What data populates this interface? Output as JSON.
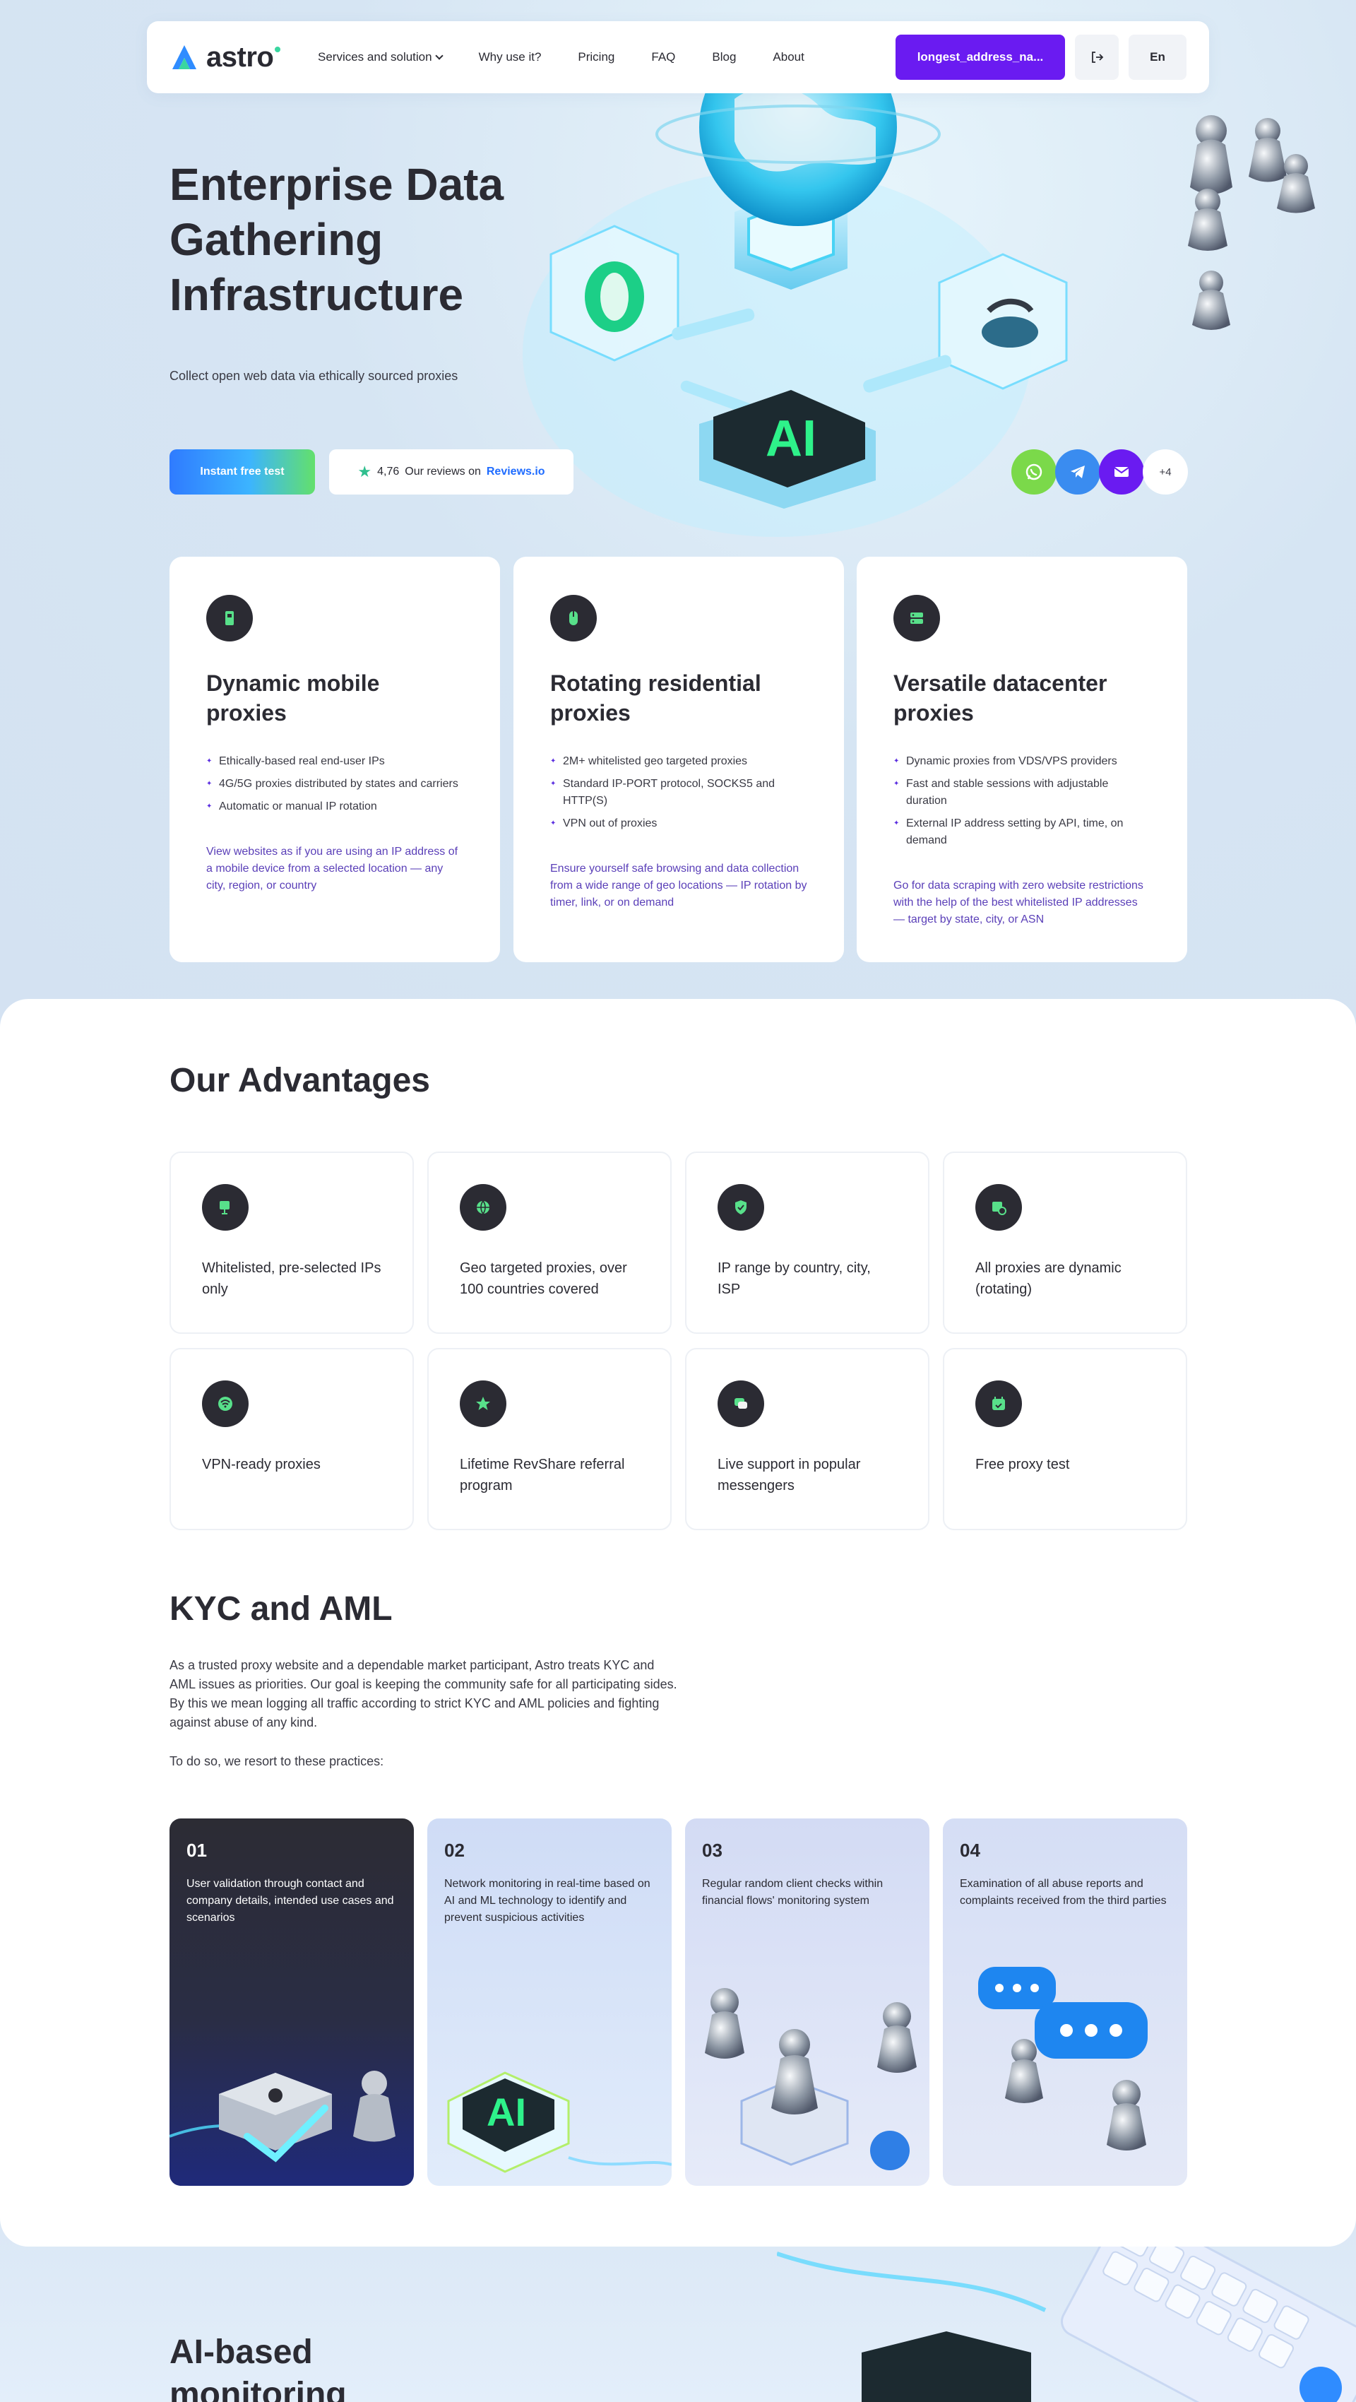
{
  "header": {
    "logo_text": "astro",
    "nav": [
      {
        "label": "Services and solution"
      },
      {
        "label": "Why use it?"
      },
      {
        "label": "Pricing"
      },
      {
        "label": "FAQ"
      },
      {
        "label": "Blog"
      },
      {
        "label": "About"
      }
    ],
    "account_label": "longest_address_na...",
    "lang": "En"
  },
  "hero": {
    "title": "Enterprise Data Gathering Infrastructure",
    "subtitle": "Collect open web data via ethically sourced proxies",
    "cta_label": "Instant free test",
    "rating": "4,76",
    "reviews_text": "Our reviews on",
    "reviews_link": "Reviews.io",
    "more_count": "+4",
    "illustration_text": "AI"
  },
  "proxy_cards": [
    {
      "title": "Dynamic mobile proxies",
      "bullets": [
        "Ethically-based real end-user IPs",
        "4G/5G proxies distributed by states and carriers",
        "Automatic or manual IP rotation"
      ],
      "desc": "View websites as if you are using an IP address of a mobile device from a selected location — any city, region, or country"
    },
    {
      "title": "Rotating residential proxies",
      "bullets": [
        "2M+ whitelisted geo targeted proxies",
        "Standard IP-PORT protocol, SOCKS5 and HTTP(S)",
        "VPN out of proxies"
      ],
      "desc": "Ensure yourself safe browsing and data collection from a wide range of geo locations — IP rotation by timer, link, or on demand"
    },
    {
      "title": "Versatile datacenter proxies",
      "bullets": [
        "Dynamic proxies from VDS/VPS providers",
        "Fast and stable sessions with adjustable duration",
        "External IP address setting by API, time, on demand"
      ],
      "desc": "Go for data scraping with zero website restrictions with the help of the best whitelisted IP addresses — target by state, city, or ASN"
    }
  ],
  "advantages": {
    "title": "Our Advantages",
    "items": [
      {
        "text": "Whitelisted, pre-selected IPs only"
      },
      {
        "text": "Geo targeted proxies, over 100 countries covered"
      },
      {
        "text": "IP range by country, city, ISP"
      },
      {
        "text": "All proxies are dynamic (rotating)"
      },
      {
        "text": "VPN-ready proxies"
      },
      {
        "text": "Lifetime RevShare referral program"
      },
      {
        "text": "Live support in popular messengers"
      },
      {
        "text": "Free proxy test"
      }
    ]
  },
  "kyc": {
    "title": "KYC and AML",
    "paragraph1": "As a trusted proxy website and a dependable market participant, Astro treats KYC and AML issues as priorities. Our goal is keeping the community safe for all participating sides. By this we mean logging all traffic according to strict KYC and AML policies and fighting against abuse of any kind.",
    "paragraph2": "To do so, we resort to these practices:",
    "cards": [
      {
        "num": "01",
        "text": "User validation through contact and company details, intended use cases and scenarios"
      },
      {
        "num": "02",
        "text": "Network monitoring in real-time based on AI and ML technology to identify and prevent suspicious activities"
      },
      {
        "num": "03",
        "text": "Regular random client checks within financial flows' monitoring system"
      },
      {
        "num": "04",
        "text": "Examination of all abuse reports and complaints received from the third parties"
      }
    ]
  },
  "monitoring": {
    "title": "AI-based monitoring"
  },
  "colors": {
    "accent": "#6a1bf1",
    "dark": "#2b2b33",
    "link": "#1f6cff",
    "green": "#3ad6a0"
  }
}
